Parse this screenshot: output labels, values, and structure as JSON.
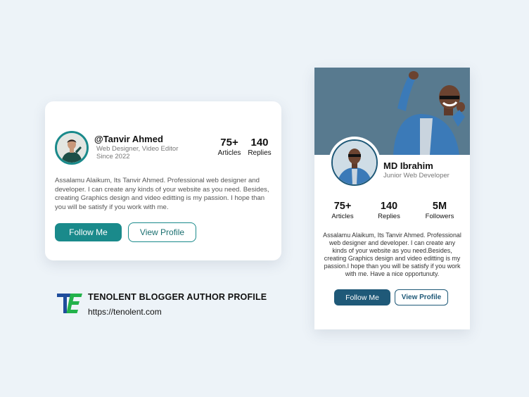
{
  "card_one": {
    "avatar_icon": "person-portrait-icon",
    "handle": "@Tanvir Ahmed",
    "role": "Web Designer, Video Editor",
    "since": "Since 2022",
    "stats": [
      {
        "value": "75+",
        "label": "Articles"
      },
      {
        "value": "140",
        "label": "Replies"
      }
    ],
    "bio": "Assalamu Alaikum, Its Tanvir Ahmed. Professional web designer and developer. I can create any kinds of your website as you need. Besides, creating Graphics design and video editting is my passion. I hope than you will be satisfy if you work with me.",
    "follow_label": "Follow Me",
    "view_label": "View Profile",
    "accent": "#1a8a8b"
  },
  "brand": {
    "logo_icon": "te-logo-icon",
    "title": "TENOLENT BLOGGER AUTHOR PROFILE",
    "url": "https://tenolent.com"
  },
  "card_two": {
    "banner_icon": "banner-photo-icon",
    "avatar_icon": "person-portrait-icon",
    "name": "MD Ibrahim",
    "role": "Junior Web Developer",
    "stats": [
      {
        "value": "75+",
        "label": "Articles"
      },
      {
        "value": "140",
        "label": "Replies"
      },
      {
        "value": "5M",
        "label": "Followers"
      }
    ],
    "bio": "Assalamu Alaikum, Its Tanvir Ahmed. Professional web designer and developer. I can create any kinds of your website as you need.Besides, creating Graphics design and video editting is my passion.I hope than you will be satisfy if you work with me. Have a nice opportunuty.",
    "follow_label": "Follow Me",
    "view_label": "View Profile",
    "accent": "#1f5978",
    "banner_color": "#587a8f"
  }
}
